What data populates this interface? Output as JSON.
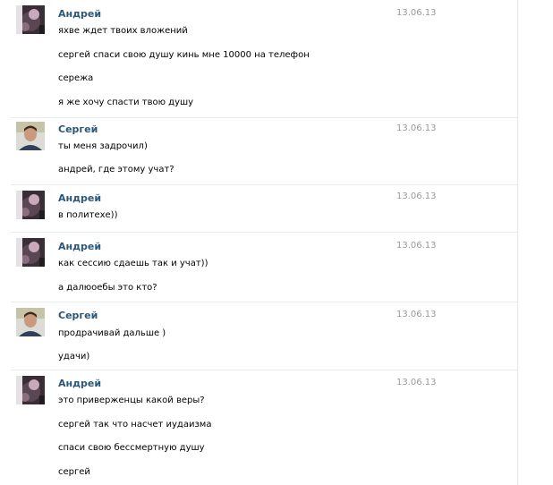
{
  "colors": {
    "author": "#2b587a",
    "date": "#999999",
    "text": "#000000",
    "divider": "#e8ecef"
  },
  "messages": [
    {
      "author": "Андрей",
      "avatar": "avatar-andrey",
      "date": "13.06.13",
      "lines": [
        "яхве ждет твоих вложений",
        "сергей спаси свою душу кинь мне 10000 на телефон",
        "сережа",
        "я же хочу спасти твою душу"
      ]
    },
    {
      "author": "Сергей",
      "avatar": "avatar-sergey",
      "date": "13.06.13",
      "lines": [
        "ты меня задрочил)",
        "андрей, где этому учат?"
      ]
    },
    {
      "author": "Андрей",
      "avatar": "avatar-andrey",
      "date": "13.06.13",
      "lines": [
        "в политехе))"
      ]
    },
    {
      "author": "Андрей",
      "avatar": "avatar-andrey",
      "date": "13.06.13",
      "lines": [
        "как сессию сдаешь так и учат))",
        "а далюоебы это кто?"
      ]
    },
    {
      "author": "Сергей",
      "avatar": "avatar-sergey",
      "date": "13.06.13",
      "lines": [
        "продрачивай дальше )",
        "удачи)"
      ]
    },
    {
      "author": "Андрей",
      "avatar": "avatar-andrey",
      "date": "13.06.13",
      "lines": [
        "это приверженцы какой веры?",
        "сергей так что насчет иудаизма",
        "спаси свою бессмертную душу",
        "сергей"
      ]
    }
  ]
}
